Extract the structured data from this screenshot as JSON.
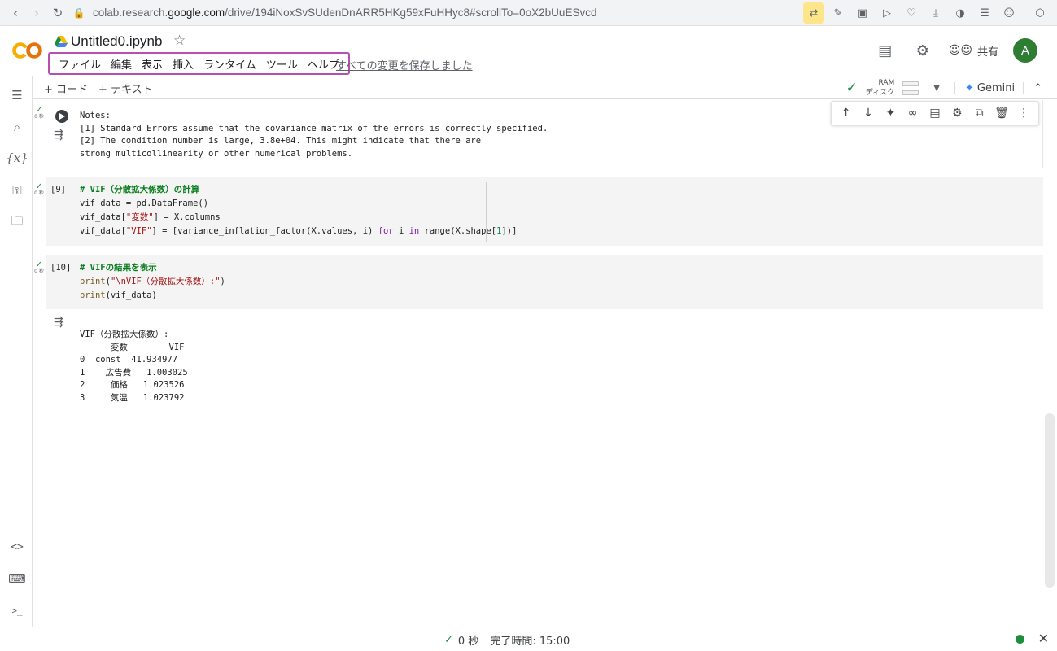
{
  "browser": {
    "url_prefix": "colab.research.",
    "url_domain": "google.com",
    "url_path": "/drive/194iNoxSvSUdenDnARR5HKg59xFuHHyc8#scrollTo=0oX2bUuESvcd"
  },
  "header": {
    "notebook_title": "Untitled0.ipynb",
    "menu": [
      "ファイル",
      "編集",
      "表示",
      "挿入",
      "ランタイム",
      "ツール",
      "ヘルプ"
    ],
    "save_status": "すべての変更を保存しました",
    "share_label": "共有",
    "avatar_letter": "A"
  },
  "toolbar": {
    "add_code": "+ コード",
    "add_text": "+ テキスト",
    "ram_label": "RAM",
    "disk_label": "ディスク",
    "gemini_label": "Gemini"
  },
  "cells": {
    "output_notes": {
      "time": "0 秒",
      "text": "Notes:\n[1] Standard Errors assume that the covariance matrix of the errors is correctly specified.\n[2] The condition number is large, 3.8e+04. This might indicate that there are\nstrong multicollinearity or other numerical problems."
    },
    "cell9": {
      "exec": "[9]",
      "time": "0 秒",
      "comment": "# VIF（分散拡大係数）の計算",
      "line1": "vif_data = pd.DataFrame()",
      "line2_a": "vif_data[",
      "line2_str": "\"変数\"",
      "line2_b": "] = X.columns",
      "line3_a": "vif_data[",
      "line3_str": "\"VIF\"",
      "line3_b": "] = [variance_inflation_factor(X.values, i) ",
      "line3_for": "for",
      "line3_c": " i ",
      "line3_in": "in",
      "line3_d": " range(X.shape[",
      "line3_num": "1",
      "line3_e": "])]"
    },
    "cell10": {
      "exec": "[10]",
      "time": "0 秒",
      "comment": "# VIFの結果を表示",
      "line1_fn": "print",
      "line1_a": "(",
      "line1_str": "\"\\nVIF（分散拡大係数）:\"",
      "line1_b": ")",
      "line2_fn": "print",
      "line2_a": "(vif_data)",
      "output": "VIF（分散拡大係数）:\n      変数        VIF\n0  const  41.934977\n1    広告費   1.003025\n2     価格   1.023526\n3     気温   1.023792"
    }
  },
  "status_bar": {
    "time": "0 秒",
    "completed": "完了時間: 15:00"
  },
  "colors": {
    "accent_green": "#1e8e3e",
    "menu_highlight": "#b74fb3",
    "avatar_bg": "#2e7d32"
  }
}
